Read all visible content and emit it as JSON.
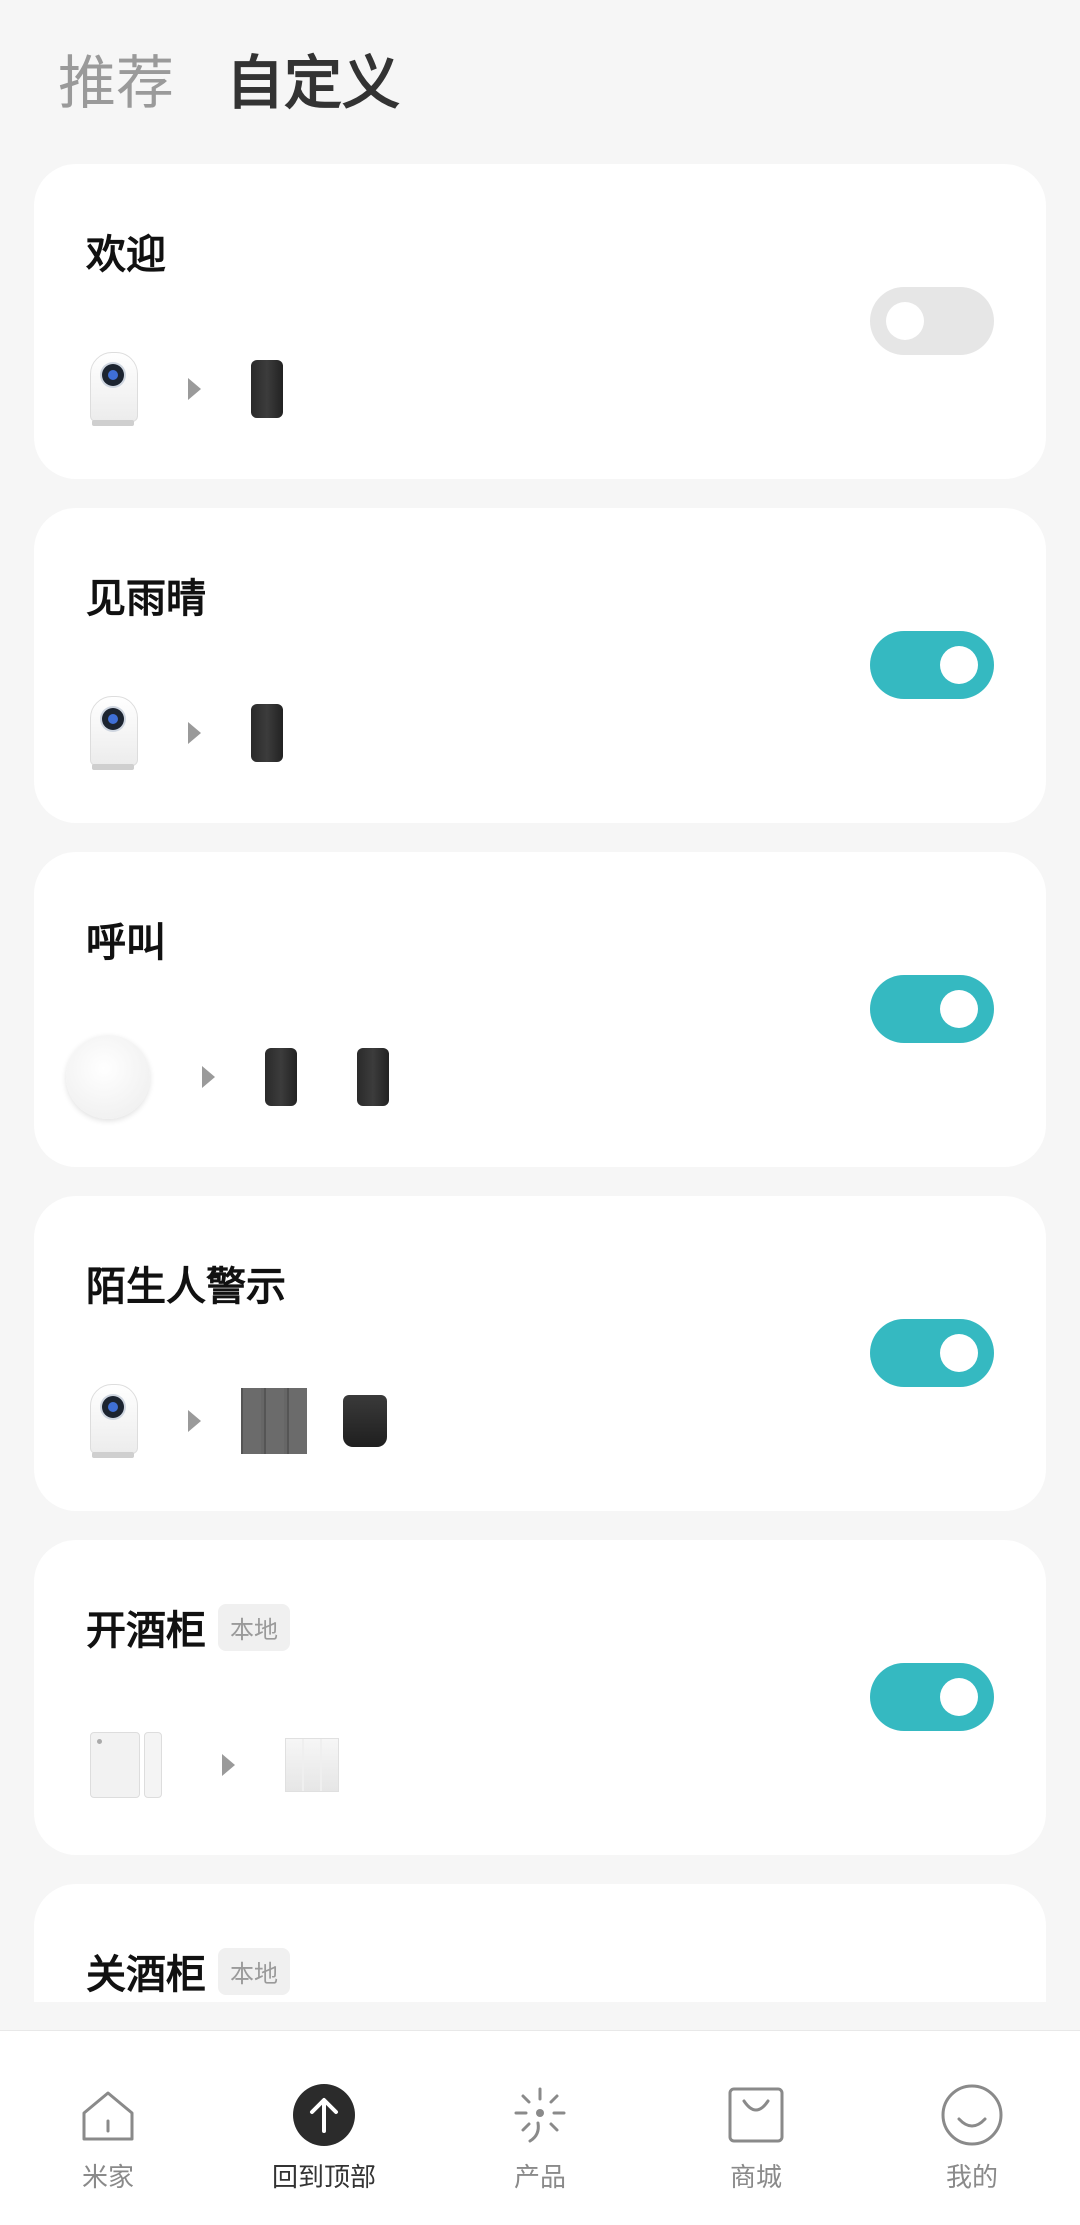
{
  "tabs": [
    {
      "label": "推荐",
      "active": false
    },
    {
      "label": "自定义",
      "active": true
    }
  ],
  "scenes": [
    {
      "name": "欢迎",
      "badge": "",
      "enabled": false
    },
    {
      "name": "见雨晴",
      "badge": "",
      "enabled": true
    },
    {
      "name": "呼叫",
      "badge": "",
      "enabled": true
    },
    {
      "name": "陌生人警示",
      "badge": "",
      "enabled": true
    },
    {
      "name": "开酒柜",
      "badge": "本地",
      "enabled": true
    },
    {
      "name": "关酒柜",
      "badge": "本地",
      "enabled": null
    }
  ],
  "nav": [
    {
      "label": "米家",
      "icon": "home-icon"
    },
    {
      "label": "回到顶部",
      "icon": "arrow-up-icon",
      "active": true
    },
    {
      "label": "产品",
      "icon": "sparkle-icon"
    },
    {
      "label": "商城",
      "icon": "shopping-bag-icon"
    },
    {
      "label": "我的",
      "icon": "smile-icon"
    }
  ],
  "colors": {
    "accent": "#35b9c1",
    "toggle_off": "#e6e6e6",
    "background": "#f6f6f6"
  }
}
